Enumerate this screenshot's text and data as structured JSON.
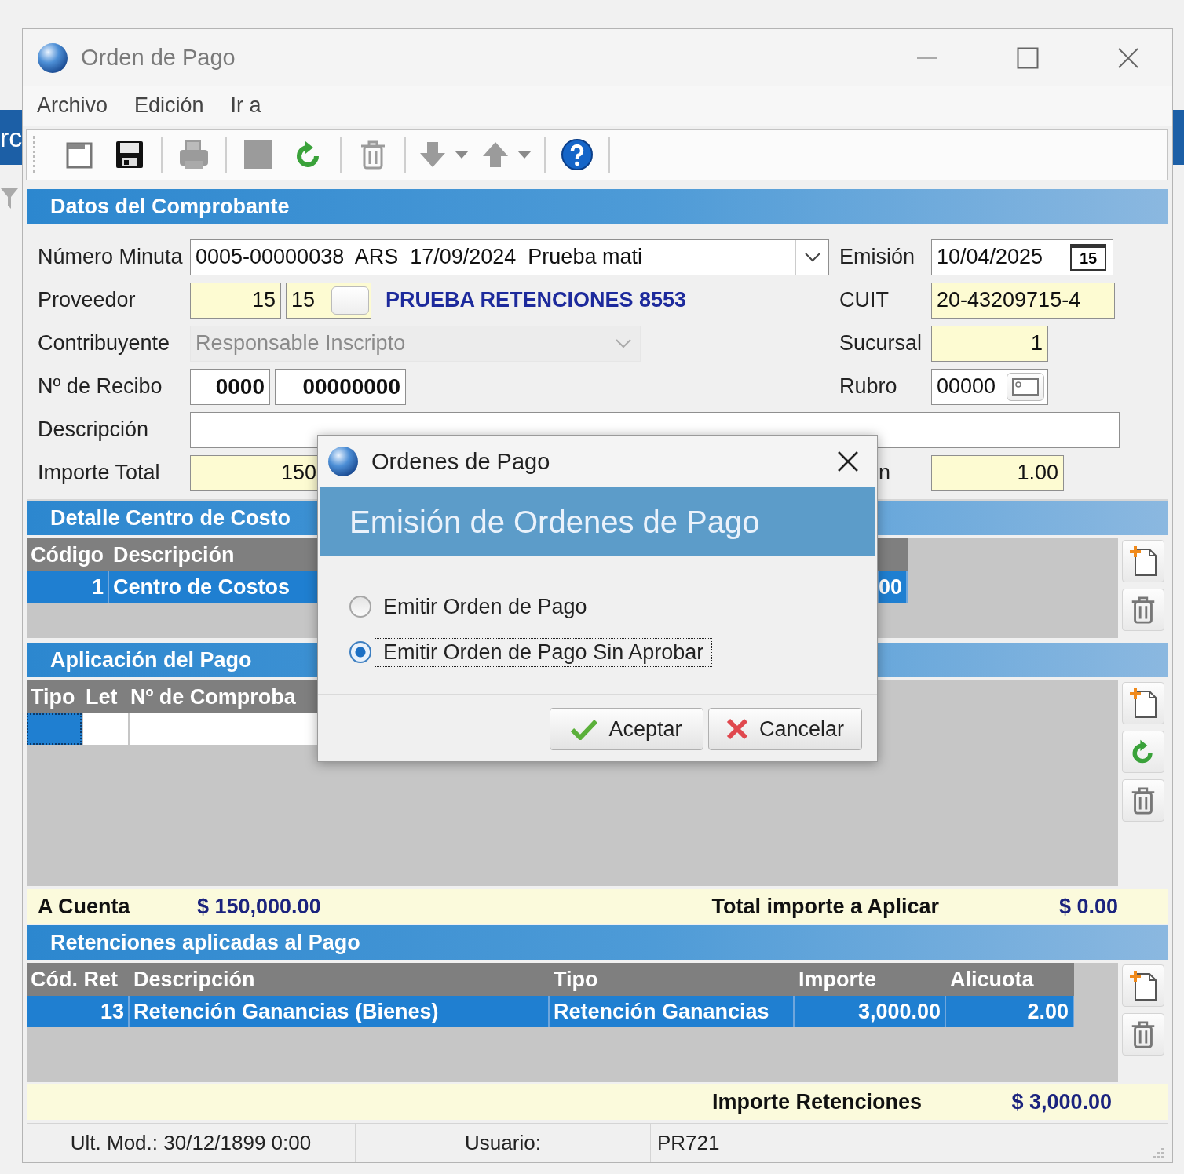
{
  "background_app": {
    "text": "rc"
  },
  "window": {
    "title": "Orden de Pago"
  },
  "menu": [
    {
      "label": "Archivo"
    },
    {
      "label": "Edición"
    },
    {
      "label": "Ir a"
    }
  ],
  "toolbar": [
    {
      "items": [
        {
          "kind": "new",
          "disabled": true
        },
        {
          "kind": "save",
          "disabled": false
        }
      ]
    },
    {
      "items": [
        {
          "kind": "print",
          "disabled": true
        }
      ]
    },
    {
      "items": [
        {
          "kind": "stop",
          "disabled": true
        },
        {
          "kind": "refresh",
          "disabled": false
        }
      ]
    },
    {
      "items": [
        {
          "kind": "delete",
          "disabled": true
        }
      ]
    },
    {
      "items": [
        {
          "kind": "down",
          "disabled": true,
          "has_menu": true
        },
        {
          "kind": "up",
          "disabled": true,
          "has_menu": true
        }
      ]
    },
    {
      "items": [
        {
          "kind": "help",
          "disabled": false
        }
      ]
    }
  ],
  "comprobante": {
    "title": "Datos del Comprobante",
    "numero_minuta": {
      "label": "Número Minuta",
      "value": "0005-00000038  ARS  17/09/2024  Prueba mati"
    },
    "emision": {
      "label": "Emisión",
      "value": "10/04/2025",
      "calendar_day": "15"
    },
    "proveedor": {
      "label": "Proveedor",
      "code": "15",
      "code_2": "15",
      "name": "PRUEBA RETENCIONES 8553"
    },
    "cuit": {
      "label": "CUIT",
      "value": "20-43209715-4"
    },
    "contribuyente": {
      "label": "Contribuyente",
      "value": "Responsable Inscripto",
      "disabled": true
    },
    "sucursal": {
      "label": "Sucursal",
      "value": "1"
    },
    "recibo": {
      "label": "Nº de Recibo",
      "punto_venta": "0000",
      "numero": "00000000"
    },
    "rubro": {
      "label": "Rubro",
      "value": "00000"
    },
    "descripcion": {
      "label": "Descripción"
    },
    "importe_total": {
      "label": "Importe Total",
      "value": "150"
    },
    "field_8": {
      "label": "n",
      "value": "1.00"
    }
  },
  "centro_costos": {
    "title": "Detalle Centro de Costo",
    "columns": [
      "Código",
      "Descripción"
    ],
    "rows": [
      {
        "cells": [
          "1",
          "Centro de Costos",
          "00"
        ],
        "selected": true
      }
    ],
    "actions": [
      {
        "kind": "add"
      },
      {
        "kind": "delete"
      }
    ]
  },
  "aplicacion": {
    "title": "Aplicación del Pago",
    "columns": [
      "Tipo",
      "Let",
      "Nº de Comproba"
    ],
    "rows": [
      {
        "focused": true
      }
    ],
    "actions": [
      {
        "kind": "add"
      },
      {
        "kind": "refresh"
      },
      {
        "kind": "delete"
      }
    ],
    "a_cuenta_label": "A Cuenta",
    "a_cuenta": "$ 150,000.00",
    "total_label": "Total importe a Aplicar",
    "total": "$ 0.00"
  },
  "retenciones": {
    "title": "Retenciones aplicadas al Pago",
    "columns": [
      "Cód. Ret",
      "Descripción",
      "Tipo",
      "Importe",
      "Alicuota"
    ],
    "rows": [
      {
        "cells": [
          "13",
          "Retención Ganancias (Bienes)",
          "Retención Ganancias",
          "3,000.00",
          "2.00"
        ],
        "selected": true
      }
    ],
    "actions": [
      {
        "kind": "add"
      },
      {
        "kind": "delete"
      }
    ],
    "total_label": "Importe Retenciones",
    "total": "$ 3,000.00"
  },
  "status_bar": {
    "ult_mod": "Ult. Mod.: 30/12/1899 0:00",
    "usuario_label": "Usuario:",
    "usuario": "PR721"
  },
  "dialog": {
    "title": "Ordenes de Pago",
    "heading": "Emisión de Ordenes de Pago",
    "options": [
      {
        "label": "Emitir Orden de Pago",
        "selected": false
      },
      {
        "label": "Emitir Orden de Pago Sin Aprobar",
        "selected": true
      }
    ],
    "buttons": [
      {
        "label": "Aceptar",
        "kind": "accept"
      },
      {
        "label": "Cancelar",
        "kind": "cancel"
      }
    ]
  }
}
